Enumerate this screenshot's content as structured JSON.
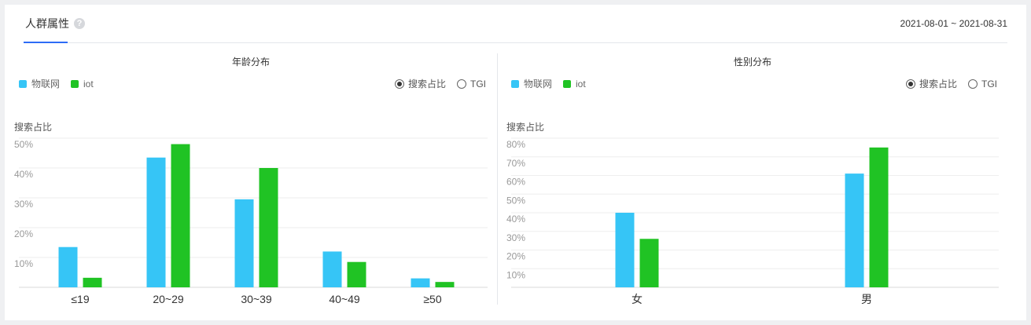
{
  "tab": {
    "label": "人群属性",
    "help_icon": "question-circle-icon"
  },
  "date_range": "2021-08-01 ~ 2021-08-31",
  "legend": [
    {
      "name": "物联网",
      "color": "#36c5f6"
    },
    {
      "name": "iot",
      "color": "#20c324"
    }
  ],
  "radio_options": {
    "selected": "搜索占比",
    "other": "TGI"
  },
  "chart_data": [
    {
      "type": "bar",
      "title": "年龄分布",
      "ylabel": "搜索占比",
      "categories": [
        "≤19",
        "20~29",
        "30~39",
        "40~49",
        "≥50"
      ],
      "series": [
        {
          "name": "物联网",
          "values": [
            13.5,
            43.5,
            29.5,
            12,
            3
          ]
        },
        {
          "name": "iot",
          "values": [
            3.2,
            48,
            40,
            8.5,
            1.8
          ]
        }
      ],
      "ylim": [
        0,
        50
      ],
      "yticks": [
        "10%",
        "20%",
        "30%",
        "40%",
        "50%"
      ],
      "grid": true,
      "legend_position": "top-left"
    },
    {
      "type": "bar",
      "title": "性别分布",
      "ylabel": "搜索占比",
      "categories": [
        "女",
        "男"
      ],
      "series": [
        {
          "name": "物联网",
          "values": [
            40,
            61
          ]
        },
        {
          "name": "iot",
          "values": [
            26,
            75
          ]
        }
      ],
      "ylim": [
        0,
        80
      ],
      "yticks": [
        "10%",
        "20%",
        "30%",
        "40%",
        "50%",
        "60%",
        "70%",
        "80%"
      ],
      "grid": true,
      "legend_position": "top-left"
    }
  ]
}
